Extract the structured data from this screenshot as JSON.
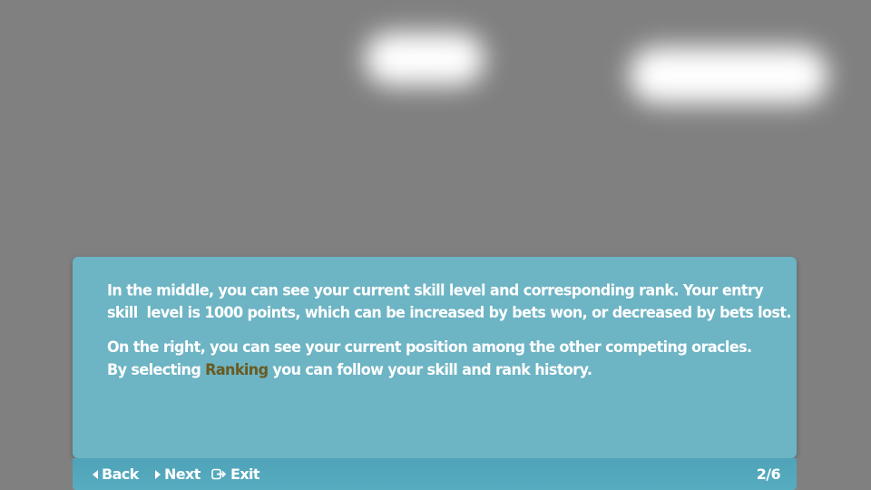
{
  "tutorial": {
    "paragraph1": {
      "line1": "In the middle, you can see your current skill level and corresponding rank. Your entry",
      "line2": "skill  level is 1000 points, which can be increased by bets won, or decreased by bets lost."
    },
    "paragraph2": {
      "line1": "On the right, you can see your current position among the other competing oracles.",
      "line2_before": "By selecting ",
      "line2_highlight": "Ranking",
      "line2_after": " you can follow your skill and rank history."
    }
  },
  "footer": {
    "back_label": "Back",
    "next_label": "Next",
    "exit_label": "Exit",
    "page_counter": "2/6"
  },
  "colors": {
    "background": "#808080",
    "dialog": "#6db4c4",
    "footer": "#58acc0",
    "highlight": "#6b5a1e"
  },
  "icons": {
    "back": "triangle-left-icon",
    "next": "triangle-right-icon",
    "exit": "exit-icon"
  }
}
